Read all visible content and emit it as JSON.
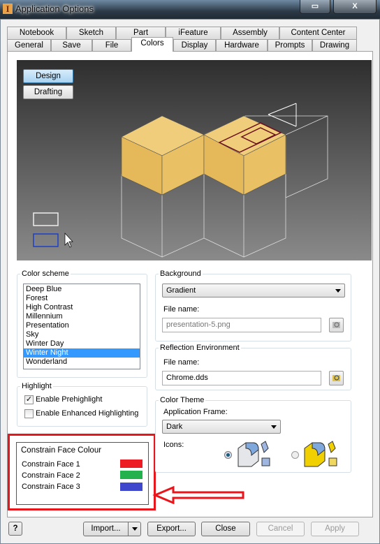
{
  "window": {
    "title": "Application Options",
    "app_icon": "I"
  },
  "tabs": {
    "row1": [
      "Notebook",
      "Sketch",
      "Part",
      "iFeature",
      "Assembly",
      "Content Center"
    ],
    "row2": [
      "General",
      "Save",
      "File",
      "Colors",
      "Display",
      "Hardware",
      "Prompts",
      "Drawing"
    ],
    "selected": "Colors"
  },
  "preview": {
    "design_label": "Design",
    "drafting_label": "Drafting"
  },
  "color_scheme": {
    "label": "Color scheme",
    "items": [
      "Deep Blue",
      "Forest",
      "High Contrast",
      "Millennium",
      "Presentation",
      "Sky",
      "Winter Day",
      "Winter Night",
      "Wonderland"
    ],
    "selected": "Winter Night"
  },
  "highlight": {
    "label": "Highlight",
    "prehighlight_label": "Enable Prehighlight",
    "prehighlight_checked": true,
    "enhanced_label": "Enable Enhanced Highlighting",
    "enhanced_checked": false
  },
  "constrain": {
    "label": "Constrain Face Colour",
    "faces": [
      {
        "label": "Constrain Face 1",
        "color": "#ed1c24"
      },
      {
        "label": "Constrain Face 2",
        "color": "#22b14c"
      },
      {
        "label": "Constrain Face 3",
        "color": "#3f48cc"
      }
    ]
  },
  "background": {
    "label": "Background",
    "value": "Gradient",
    "file_label": "File name:",
    "file_value": "presentation-5.png"
  },
  "reflection": {
    "label": "Reflection Environment",
    "file_label": "File name:",
    "file_value": "Chrome.dds"
  },
  "color_theme": {
    "label": "Color Theme",
    "frame_label": "Application Frame:",
    "frame_value": "Dark",
    "icons_label": "Icons:",
    "icons_selected": "standard"
  },
  "buttons": {
    "import": "Import...",
    "export": "Export...",
    "close": "Close",
    "cancel": "Cancel",
    "apply": "Apply"
  },
  "colors": {
    "annotation": "#e8151b",
    "face_yellow": "#e9c063"
  }
}
